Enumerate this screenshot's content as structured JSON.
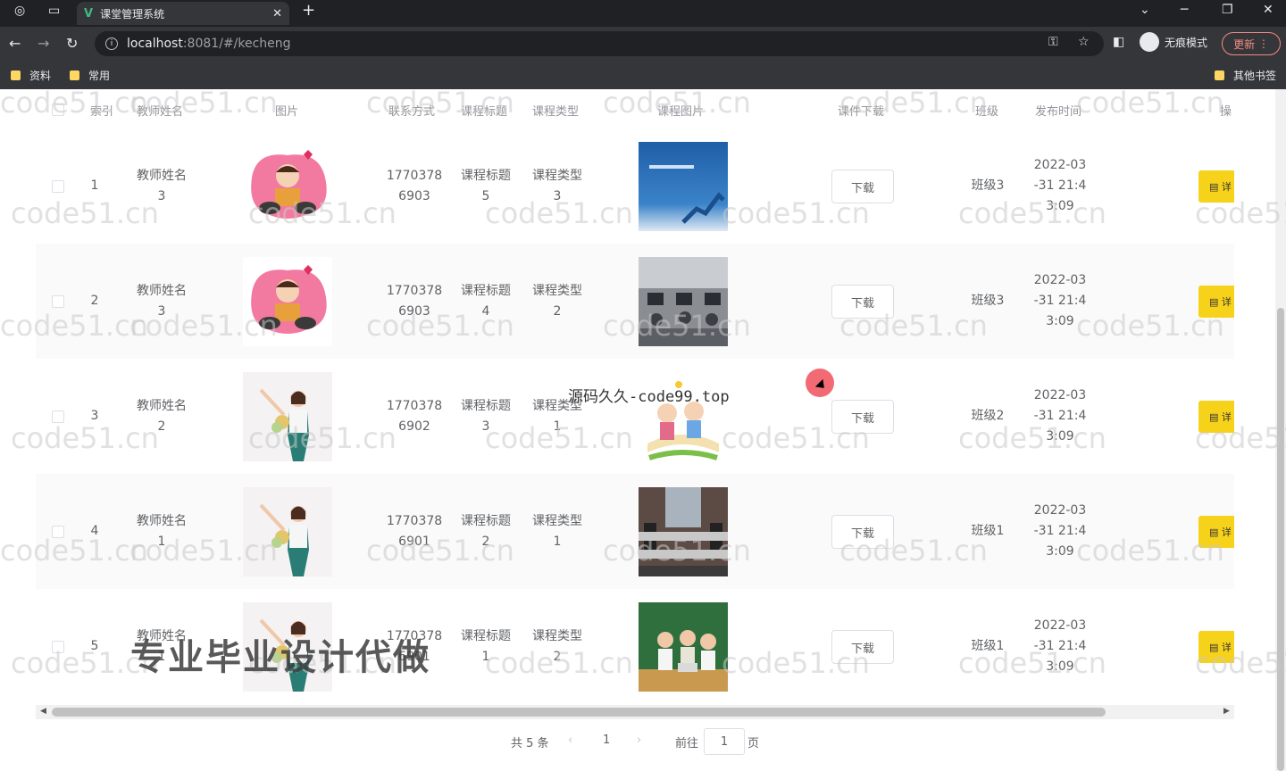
{
  "browser": {
    "tab_title": "课堂管理系统",
    "tab_icon": "V",
    "url_host": "localhost",
    "url_path": ":8081/#/kecheng",
    "incognito_label": "无痕模式",
    "update_label": "更新",
    "bookmarks": [
      "资料",
      "常用"
    ],
    "other_bookmarks": "其他书签"
  },
  "table": {
    "headers": [
      "索引",
      "教师姓名",
      "图片",
      "联系方式",
      "课程标题",
      "课程类型",
      "课程图片",
      "课件下载",
      "班级",
      "发布时间",
      "操"
    ],
    "download_label": "下载",
    "action_label": "详",
    "rows": [
      {
        "index": "1",
        "teacher": "教师姓名\n3",
        "phone": "1770378\n6903",
        "title": "课程标题\n5",
        "type": "课程类型\n3",
        "cls": "班级3",
        "time": "2022-03\n-31 21:4\n3:09",
        "avatar": "cartoon-boy",
        "course_img": "blue-slide"
      },
      {
        "index": "2",
        "teacher": "教师姓名\n3",
        "phone": "1770378\n6903",
        "title": "课程标题\n4",
        "type": "课程类型\n2",
        "cls": "班级3",
        "time": "2022-03\n-31 21:4\n3:09",
        "avatar": "cartoon-boy",
        "course_img": "classroom-photo"
      },
      {
        "index": "3",
        "teacher": "教师姓名\n2",
        "phone": "1770378\n6902",
        "title": "课程标题\n3",
        "type": "课程类型\n1",
        "cls": "班级2",
        "time": "2022-03\n-31 21:4\n3:09",
        "avatar": "woman-flowers",
        "course_img": "kids-book"
      },
      {
        "index": "4",
        "teacher": "教师姓名\n1",
        "phone": "1770378\n6901",
        "title": "课程标题\n2",
        "type": "课程类型\n1",
        "cls": "班级1",
        "time": "2022-03\n-31 21:4\n3:09",
        "avatar": "woman-flowers",
        "course_img": "computer-lab"
      },
      {
        "index": "5",
        "teacher": "教师姓名\n1",
        "phone": "1770378\n6901",
        "title": "课程标题\n1",
        "type": "课程类型\n2",
        "cls": "班级1",
        "time": "2022-03\n-31 21:4\n3:09",
        "avatar": "woman-flowers",
        "course_img": "students-green"
      }
    ]
  },
  "pagination": {
    "total": "共 5 条",
    "current_page": "1",
    "goto_label": "前往",
    "goto_value": "1",
    "page_suffix": "页"
  },
  "overlays": {
    "watermark": "code51.cn",
    "center_text": "源码久久-code99.top",
    "banner": "专业毕业设计代做"
  },
  "colors": {
    "accent": "#409eff",
    "action_yellow": "#f7d21a"
  }
}
